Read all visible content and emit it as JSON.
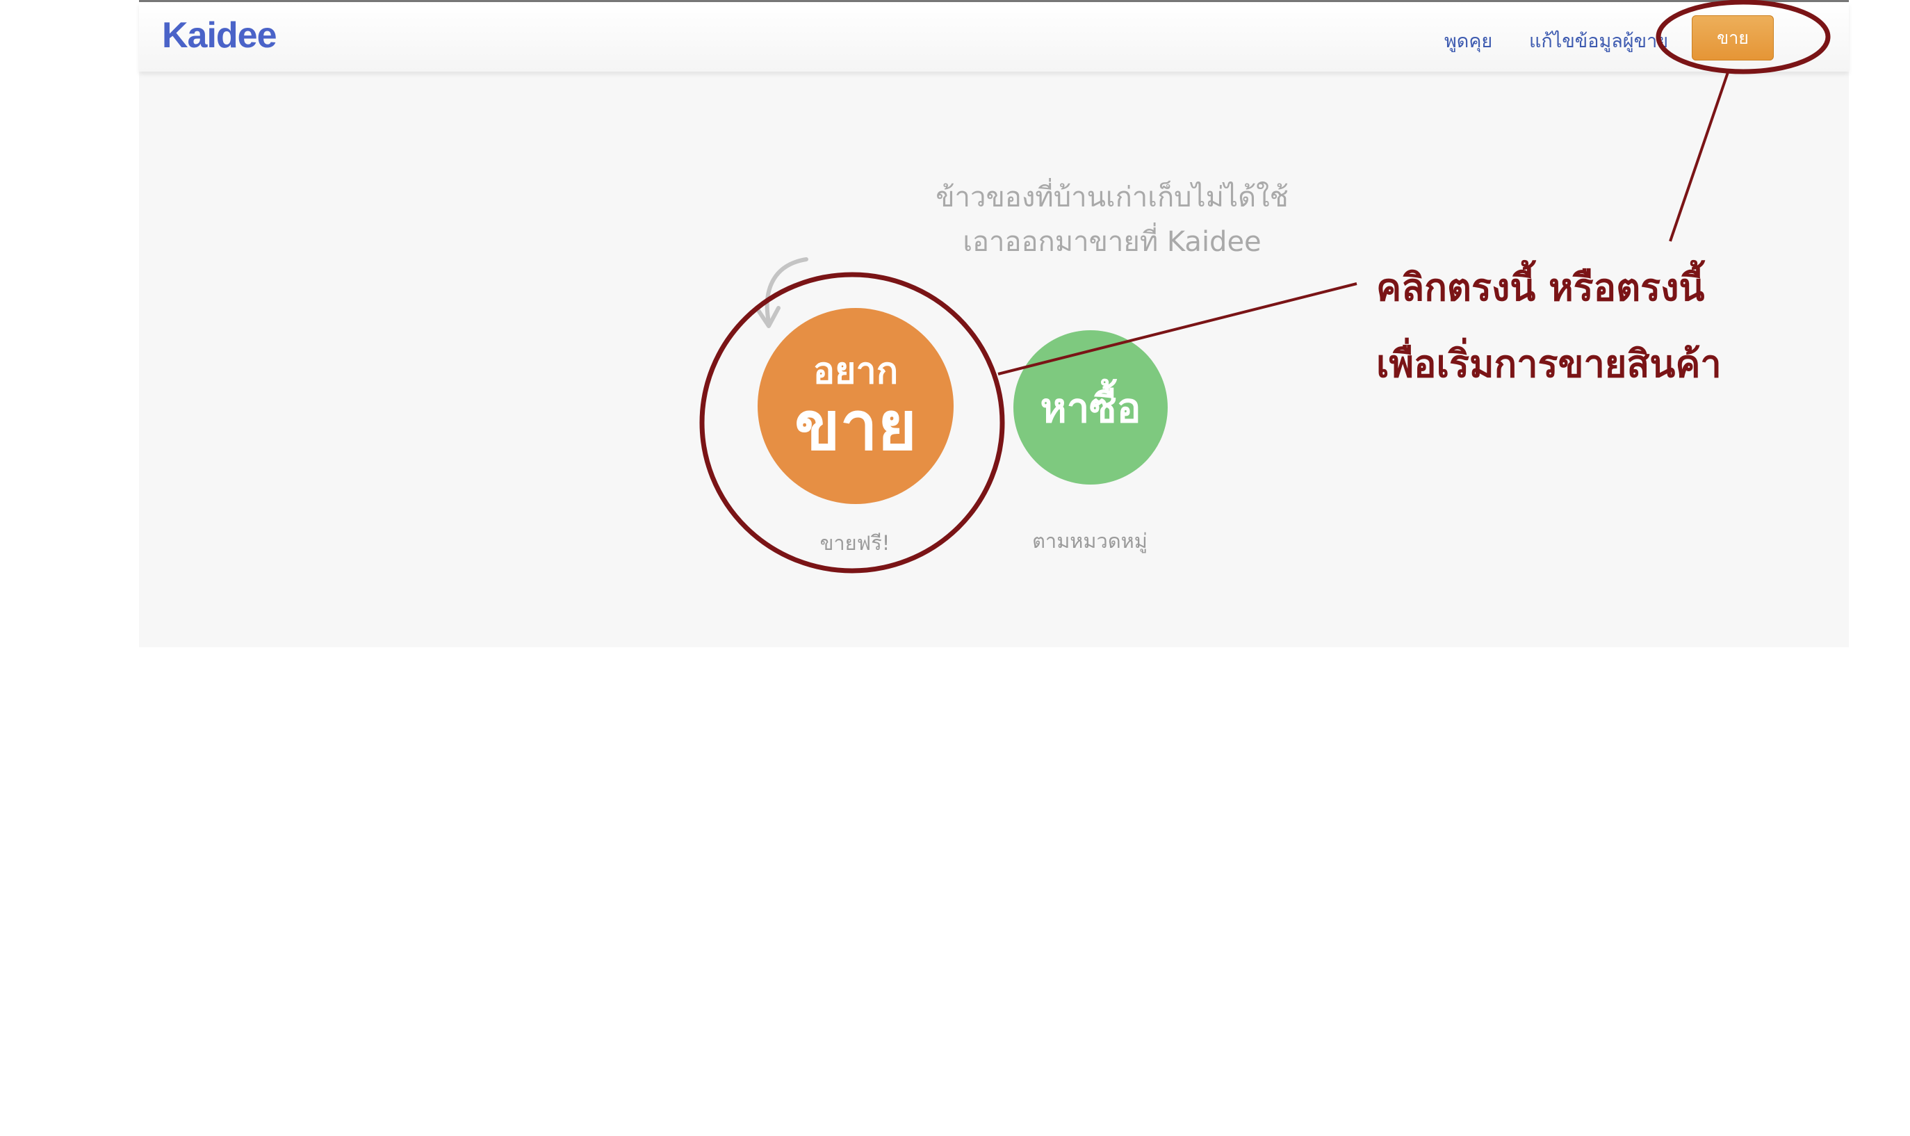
{
  "navbar": {
    "logo": "Kaidee",
    "links": [
      {
        "label": "พูดคุย"
      },
      {
        "label": "แก้ไขข้อมูลผู้ขาย"
      }
    ],
    "sell_button": "ขาย"
  },
  "hero": {
    "tagline_line1": "ข้าวของที่บ้านเก่าเก็บไม่ได้ใช้",
    "tagline_line2": "เอาออกมาขายที่ Kaidee"
  },
  "actions": {
    "sell": {
      "label_small": "อยาก",
      "label_big": "ขาย",
      "caption": "ขายฟรี!",
      "color": "#e68f44"
    },
    "buy": {
      "label": "หาซื้อ",
      "caption": "ตามหมวดหมู่",
      "color": "#7ec97f"
    }
  },
  "annotation": {
    "line1": "คลิกตรงนี้ หรือตรงนี้",
    "line2": "เพื่อเริ่มการขายสินค้า",
    "color": "#7a1416"
  }
}
